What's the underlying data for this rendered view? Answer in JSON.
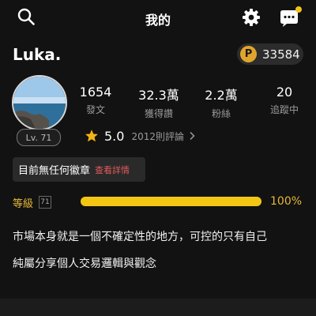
{
  "header": {
    "title": "我的",
    "icons": [
      "search-icon",
      "gear-icon",
      "chat-icon"
    ]
  },
  "profile": {
    "username": "Luka.",
    "coins": "33584",
    "coin_symbol": "P",
    "level_badge": "Lv. 71"
  },
  "stats": [
    {
      "value": "1654",
      "label": "發文"
    },
    {
      "value": "32.3萬",
      "label": "獲得讚"
    },
    {
      "value": "2.2萬",
      "label": "粉絲"
    },
    {
      "value": "20",
      "label": "追蹤中"
    }
  ],
  "rating": {
    "value": "5.0",
    "count": "2012則評論"
  },
  "badges": {
    "text": "目前無任何徽章",
    "link": "查看詳情"
  },
  "level": {
    "label": "等級",
    "number": "71",
    "progress": 1.0,
    "progress_text": "100%"
  },
  "bio": [
    "市場本身就是一個不確定性的地方，可控的只有自己",
    "純屬分享個人交易邏輯與觀念"
  ],
  "colors": {
    "background": "#121212",
    "accent_yellow": "#f3c614",
    "coin_gold": "#e0a52c",
    "link_red": "#e35a5a",
    "notification_dot": "#f0c419"
  }
}
